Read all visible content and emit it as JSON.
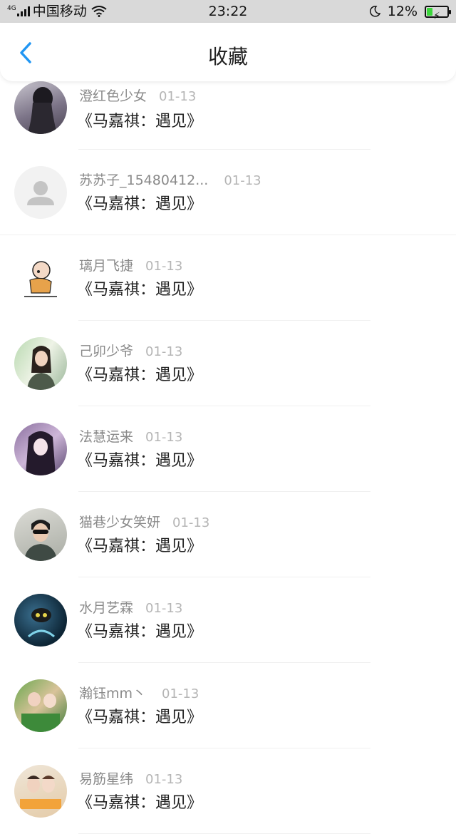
{
  "status_bar": {
    "network": "4G",
    "carrier": "中国移动",
    "time": "23:22",
    "battery": "12%",
    "battery_level": 0.12,
    "icons": [
      "signal-icon",
      "wifi-icon",
      "moon-icon",
      "battery-icon"
    ]
  },
  "header": {
    "title": "收藏",
    "back_icon": "chevron-left-icon",
    "accent": "#2196f3"
  },
  "items": [
    {
      "user": "澄红色少女",
      "date": "01-13",
      "title": "《马嘉祺：遇见》"
    },
    {
      "user": "苏苏子_15480412...",
      "date": "01-13",
      "title": "《马嘉祺：遇见》"
    },
    {
      "user": "璃月飞捷",
      "date": "01-13",
      "title": "《马嘉祺：遇见》"
    },
    {
      "user": "己卯少爷",
      "date": "01-13",
      "title": "《马嘉祺：遇见》"
    },
    {
      "user": "法慧运来",
      "date": "01-13",
      "title": "《马嘉祺：遇见》"
    },
    {
      "user": "猫巷少女笑妍",
      "date": "01-13",
      "title": "《马嘉祺：遇见》"
    },
    {
      "user": "水月艺霖",
      "date": "01-13",
      "title": "《马嘉祺：遇见》"
    },
    {
      "user": "瀚钰mm丶",
      "date": "01-13",
      "title": "《马嘉祺：遇见》"
    },
    {
      "user": "易筋星纬",
      "date": "01-13",
      "title": "《马嘉祺：遇见》"
    }
  ]
}
